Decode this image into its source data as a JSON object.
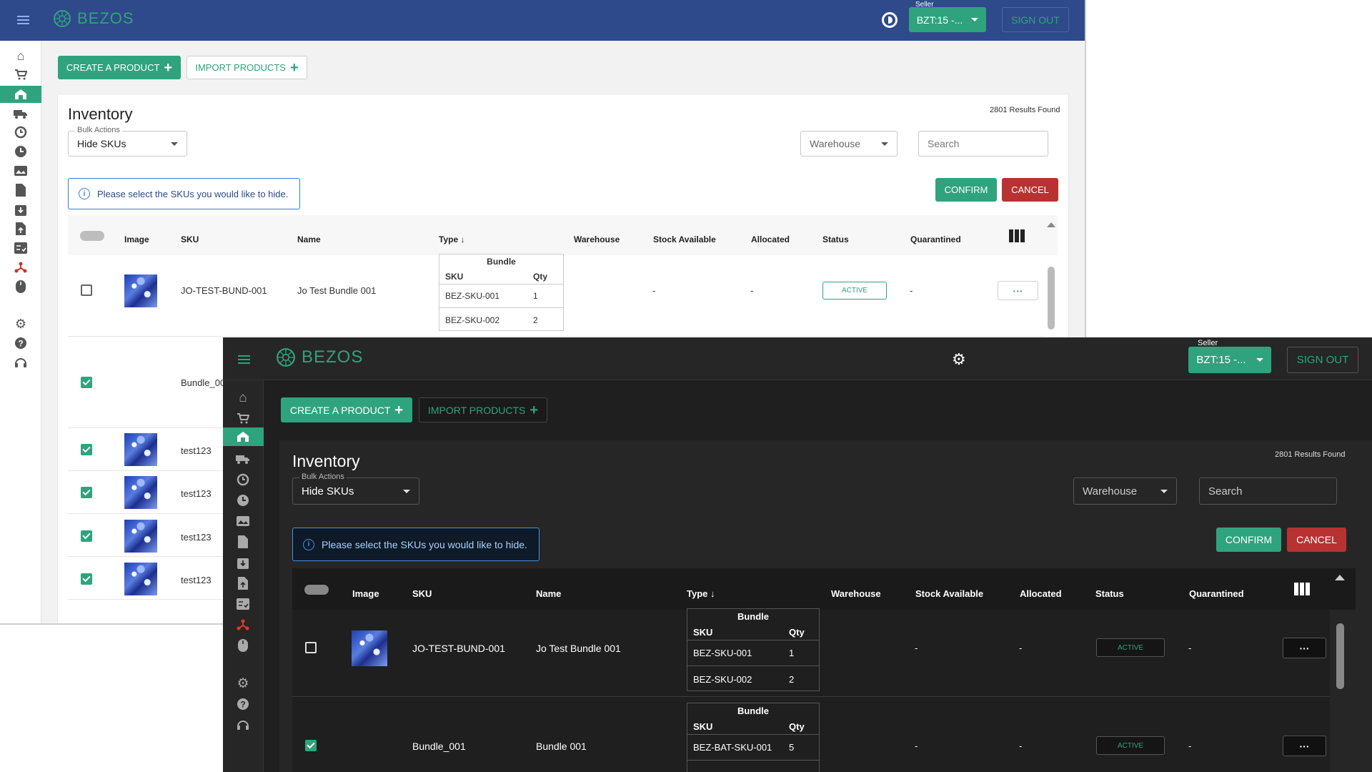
{
  "brand": "BEZOS",
  "seller_label": "Seller",
  "seller_value": "BZT:15 -...",
  "sign_out": "SIGN OUT",
  "create_product": "CREATE A PRODUCT",
  "import_products": "IMPORT PRODUCTS",
  "page_title": "Inventory",
  "results": "2801 Results Found",
  "bulk_label": "Bulk Actions",
  "bulk_value": "Hide SKUs",
  "warehouse_filter": "Warehouse",
  "search_placeholder": "Search",
  "info_text": "Please select the SKUs you would like to hide.",
  "confirm": "CONFIRM",
  "cancel": "CANCEL",
  "columns": [
    "Image",
    "SKU",
    "Name",
    "Type",
    "Warehouse",
    "Stock Available",
    "Allocated",
    "Status",
    "Quarantined"
  ],
  "bundle_header": "Bundle",
  "bundle_sku": "SKU",
  "bundle_qty": "Qty",
  "rows": [
    {
      "sku": "JO-TEST-BUND-001",
      "name": "Jo Test Bundle 001",
      "bundle": [
        {
          "sku": "BEZ-SKU-001",
          "qty": "1"
        },
        {
          "sku": "BEZ-SKU-002",
          "qty": "2"
        }
      ],
      "warehouse": "-",
      "stock": "-",
      "allocated": "-",
      "status": "ACTIVE",
      "quarantined": "-"
    },
    {
      "sku": "Bundle_001",
      "name": "Bundle 001",
      "bundle": [
        {
          "sku": "BEZ-BAT-SKU-001",
          "qty": "5"
        }
      ],
      "warehouse": "-",
      "stock": "-",
      "allocated": "-",
      "status": "ACTIVE",
      "quarantined": "-"
    }
  ],
  "light_rows_partial": [
    "Bundle_00",
    "test123",
    "test123",
    "test123",
    "test123"
  ],
  "more_glyph": "···",
  "icons": [
    "menu-icon",
    "logo-icon",
    "theme-toggle-icon",
    "home-icon",
    "cart-icon",
    "warehouse-icon",
    "truck-icon",
    "returns-icon",
    "clock-icon",
    "image-icon",
    "document-icon",
    "box-icon",
    "upload-doc-icon",
    "checklist-icon",
    "integration-icon",
    "mouse-icon",
    "settings-icon",
    "help-icon",
    "support-icon"
  ],
  "colors": {
    "light_header": "#2f4a8a",
    "accent_green": "#2fa37d",
    "cancel_red": "#b83232",
    "dark_bg": "#1f1f1f"
  }
}
